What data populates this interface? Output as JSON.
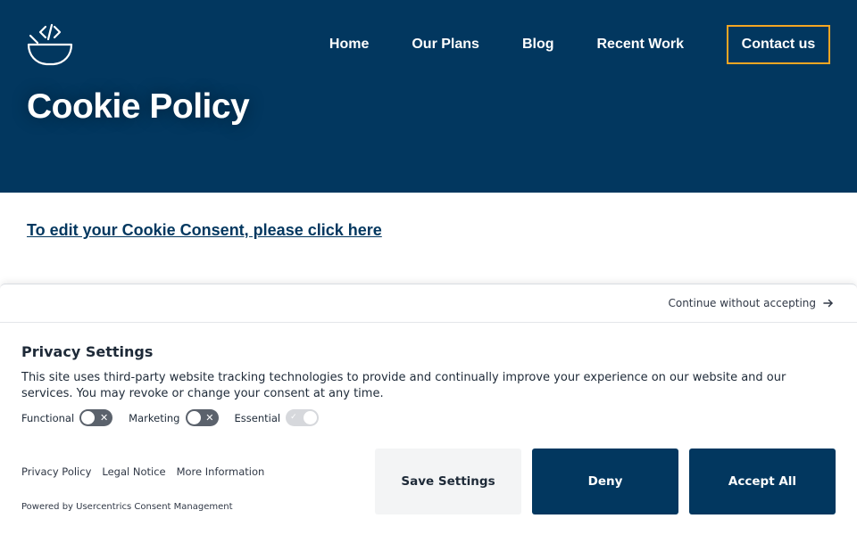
{
  "header": {
    "nav": [
      {
        "label": "Home"
      },
      {
        "label": "Our Plans"
      },
      {
        "label": "Blog"
      },
      {
        "label": "Recent Work"
      }
    ],
    "contact_label": "Contact us",
    "accent": "#f5a623",
    "background": "#02375f"
  },
  "hero": {
    "title": "Cookie Policy"
  },
  "content": {
    "consent_link": "To edit your Cookie Consent, please click here"
  },
  "banner": {
    "continue_label": "Continue without accepting",
    "title": "Privacy Settings",
    "description": "This site uses third-party website tracking technologies to provide and continually improve your experience on our website and our services. You may revoke or change your consent at any time.",
    "toggles": [
      {
        "label": "Functional",
        "state": "off"
      },
      {
        "label": "Marketing",
        "state": "off"
      },
      {
        "label": "Essential",
        "state": "on-disabled"
      }
    ],
    "links": [
      {
        "label": "Privacy Policy"
      },
      {
        "label": "Legal Notice"
      },
      {
        "label": "More Information"
      }
    ],
    "powered_by": "Powered by Usercentrics Consent Management",
    "buttons": {
      "save": "Save Settings",
      "deny": "Deny",
      "accept": "Accept All"
    }
  },
  "icons": {
    "logo": "bowl-code-logo-icon",
    "continue_arrow": "arrow-right-icon"
  }
}
